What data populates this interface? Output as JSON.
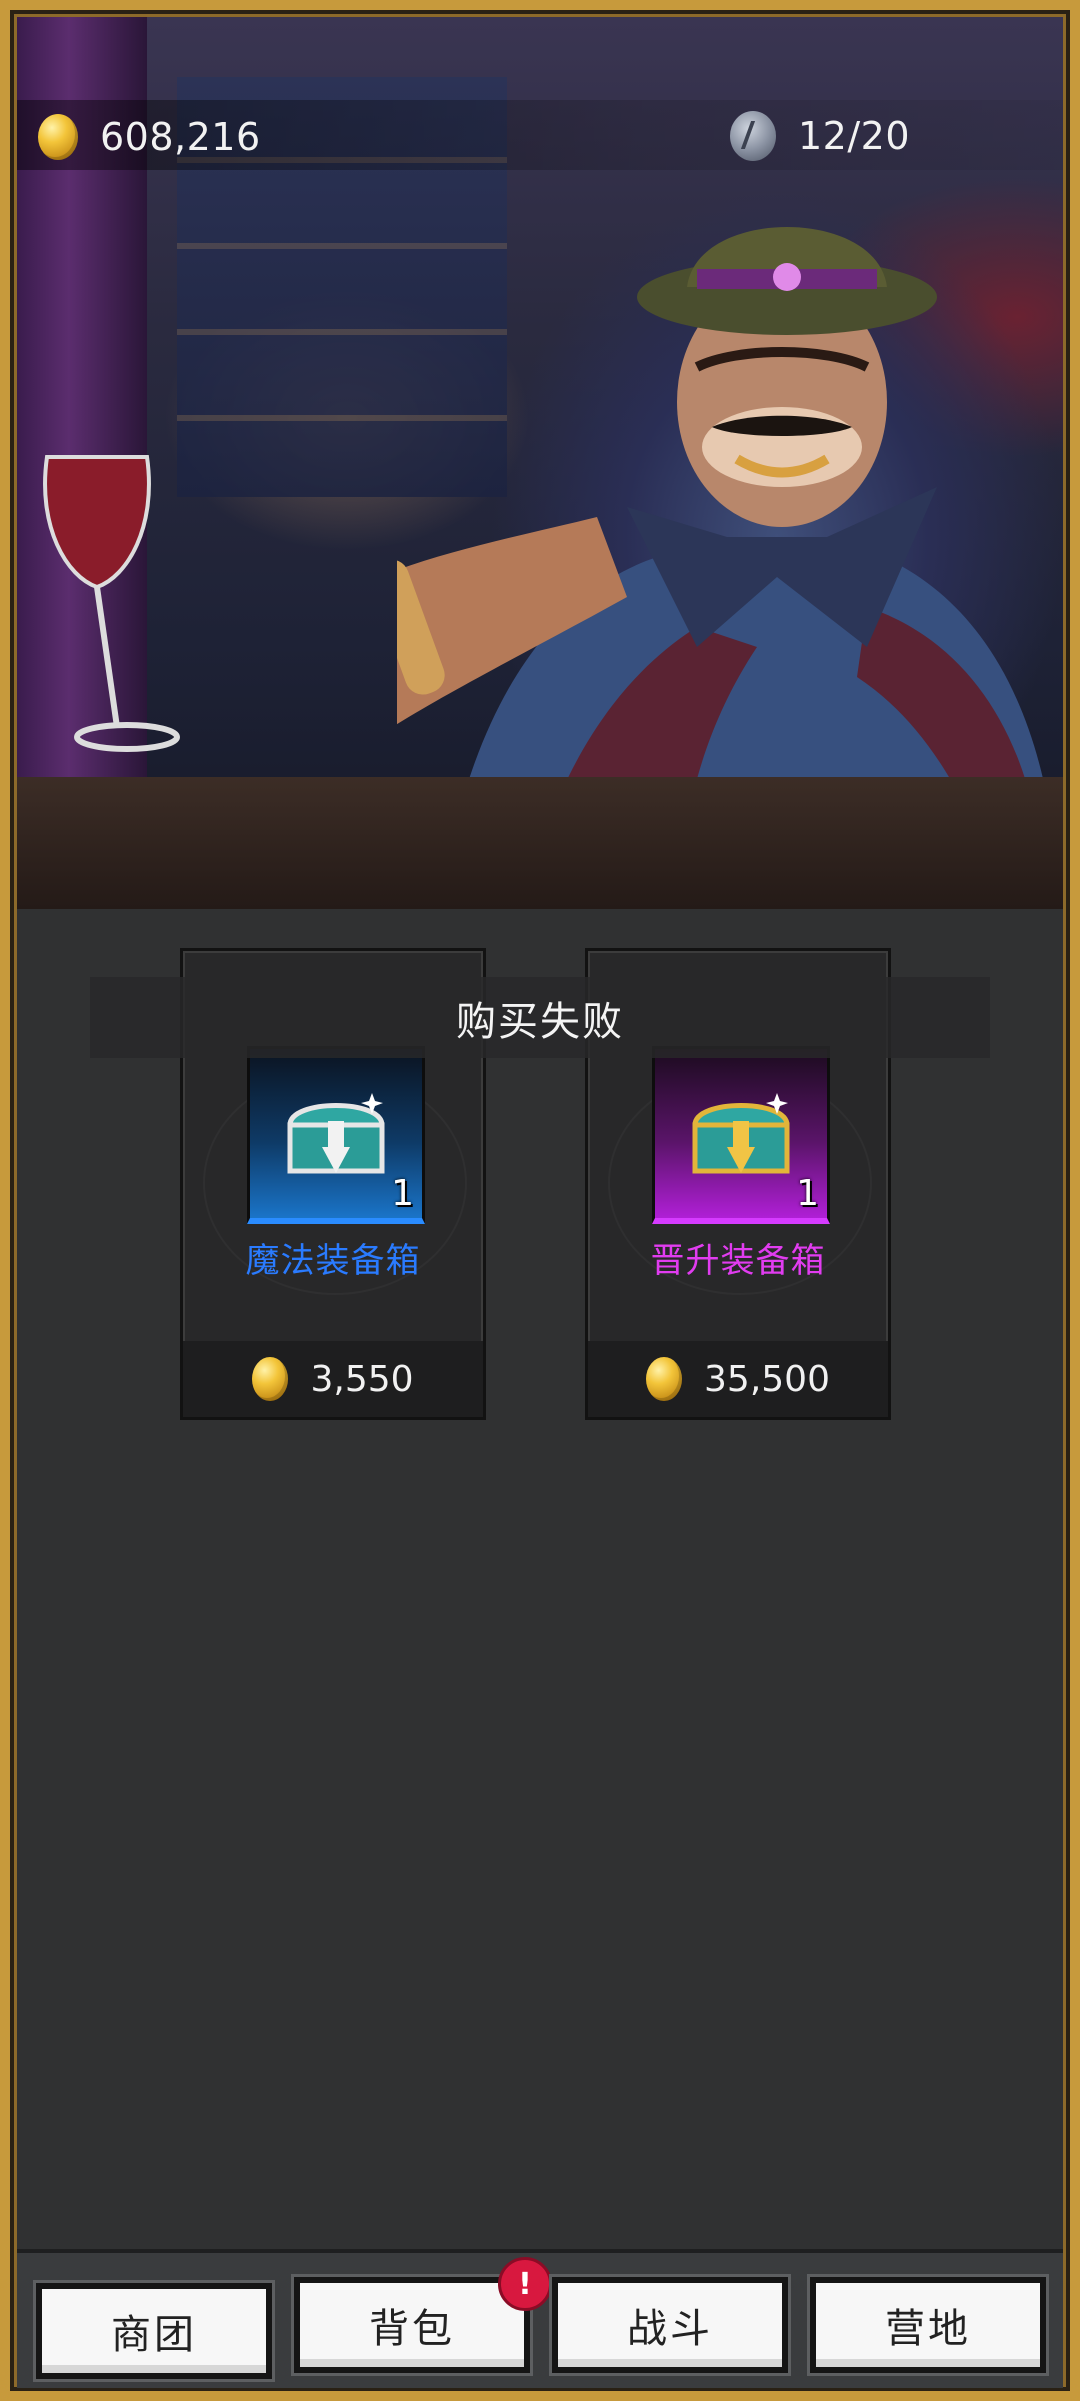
{
  "hud": {
    "gold": "608,216",
    "stamina": "12/20",
    "gold_icon": "gold-coin-icon",
    "stamina_icon": "stamina-rune-icon"
  },
  "toast": {
    "message": "购买失败"
  },
  "shop": {
    "items": [
      {
        "name": "魔法装备箱",
        "quantity": "1",
        "price": "3,550",
        "rarity_color": "#2a7bff",
        "icon": "silver-chest-icon"
      },
      {
        "name": "晋升装备箱",
        "quantity": "1",
        "price": "35,500",
        "rarity_color": "#e13cf0",
        "icon": "gold-chest-icon"
      }
    ]
  },
  "nav": {
    "items": [
      {
        "label": "商团"
      },
      {
        "label": "背包",
        "badge": "!"
      },
      {
        "label": "战斗"
      },
      {
        "label": "营地"
      }
    ]
  },
  "colors": {
    "frame": "#c79a3c",
    "background": "#303132",
    "badge": "#d8183f"
  }
}
